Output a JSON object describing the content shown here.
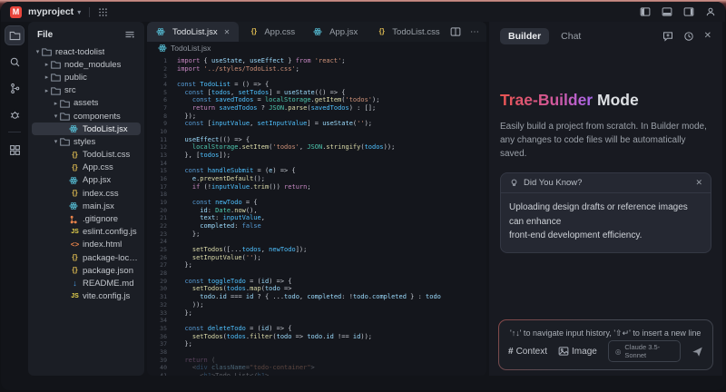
{
  "titlebar": {
    "logo_letter": "M",
    "project_name": "myproject",
    "right_icons": [
      "layout-left",
      "layout-bottom",
      "layout-right",
      "account"
    ]
  },
  "activity_bar": {
    "icons": [
      "files",
      "search",
      "source-control",
      "debug",
      "extensions"
    ],
    "active": "files"
  },
  "explorer": {
    "header": "File",
    "items": [
      {
        "indent": 0,
        "chevron": "v",
        "icon": "folder",
        "label": "react-todolist"
      },
      {
        "indent": 1,
        "chevron": ">",
        "icon": "folder",
        "label": "node_modules"
      },
      {
        "indent": 1,
        "chevron": ">",
        "icon": "folder",
        "label": "public"
      },
      {
        "indent": 1,
        "chevron": ">",
        "icon": "folder",
        "label": "src"
      },
      {
        "indent": 2,
        "chevron": ">",
        "icon": "folder",
        "label": "assets"
      },
      {
        "indent": 2,
        "chevron": "v",
        "icon": "folder",
        "label": "components"
      },
      {
        "indent": 3,
        "icon": "react",
        "label": "TodoList.jsx",
        "selected": true
      },
      {
        "indent": 2,
        "chevron": "v",
        "icon": "folder",
        "label": "styles"
      },
      {
        "indent": 3,
        "icon": "css",
        "label": "TodoList.css"
      },
      {
        "indent": 3,
        "icon": "css",
        "label": "App.css"
      },
      {
        "indent": 3,
        "icon": "react",
        "label": "App.jsx"
      },
      {
        "indent": 3,
        "icon": "css",
        "label": "index.css"
      },
      {
        "indent": 3,
        "icon": "react",
        "label": "main.jsx"
      },
      {
        "indent": 3,
        "icon": "git",
        "label": ".gitignore"
      },
      {
        "indent": 3,
        "icon": "js",
        "label": "eslint.config.js"
      },
      {
        "indent": 3,
        "icon": "html",
        "label": "index.html"
      },
      {
        "indent": 3,
        "icon": "json",
        "label": "package-lock.json"
      },
      {
        "indent": 3,
        "icon": "json",
        "label": "package.json"
      },
      {
        "indent": 3,
        "icon": "md",
        "label": "README.md"
      },
      {
        "indent": 3,
        "icon": "js",
        "label": "vite.config.js"
      }
    ]
  },
  "editor": {
    "tabs": [
      {
        "label": "TodoList.jsx",
        "icon": "react",
        "active": true,
        "close": true
      },
      {
        "label": "App.css",
        "icon": "css",
        "active": false
      },
      {
        "label": "App.jsx",
        "icon": "react",
        "active": false
      },
      {
        "label": "TodoList.css",
        "icon": "css",
        "active": false
      }
    ],
    "breadcrumb": "TodoList.jsx",
    "lines": [
      {
        "n": 1,
        "t": [
          "kw|import",
          "pn| { ",
          "id|useState",
          "pn|, ",
          "id|useEffect",
          "pn| } ",
          "kw|from",
          "st| 'react'",
          "pn|;"
        ]
      },
      {
        "n": 2,
        "t": [
          "kw|import",
          "st| '../styles/TodoList.css'",
          "pn|;"
        ]
      },
      {
        "n": 3,
        "t": []
      },
      {
        "n": 4,
        "t": [
          "cb|const ",
          "cn|TodoList",
          "pn| = () => {"
        ]
      },
      {
        "n": 5,
        "t": [
          "pn|  ",
          "cb|const ",
          "pn|[",
          "cn|todos",
          "pn|, ",
          "cn|setTodos",
          "pn|] = ",
          "id|useState",
          "pn|(() => {"
        ]
      },
      {
        "n": 6,
        "t": [
          "pn|    ",
          "cb|const ",
          "cn|savedTodos",
          "pn| = ",
          "tp|localStorage",
          "pn|.",
          "fn|getItem",
          "pn|(",
          "st|'todos'",
          "pn|);"
        ]
      },
      {
        "n": 7,
        "t": [
          "pn|    ",
          "kw|return ",
          "cn|savedTodos",
          "pn| ? ",
          "tp|JSON",
          "pn|.",
          "fn|parse",
          "pn|(",
          "cn|savedTodos",
          "pn|) : [];"
        ]
      },
      {
        "n": 8,
        "t": [
          "pn|  });"
        ]
      },
      {
        "n": 9,
        "t": [
          "pn|  ",
          "cb|const ",
          "pn|[",
          "cn|inputValue",
          "pn|, ",
          "cn|setInputValue",
          "pn|] = ",
          "id|useState",
          "pn|(",
          "st|''",
          "pn|);"
        ]
      },
      {
        "n": 10,
        "t": []
      },
      {
        "n": 11,
        "t": [
          "pn|  ",
          "id|useEffect",
          "pn|(() => {"
        ]
      },
      {
        "n": 12,
        "t": [
          "pn|    ",
          "tp|localStorage",
          "pn|.",
          "fn|setItem",
          "pn|(",
          "st|'todos'",
          "pn|, ",
          "tp|JSON",
          "pn|.",
          "fn|stringify",
          "pn|(",
          "cn|todos",
          "pn|));"
        ]
      },
      {
        "n": 13,
        "t": [
          "pn|  }, [",
          "cn|todos",
          "pn|]);"
        ]
      },
      {
        "n": 14,
        "t": []
      },
      {
        "n": 15,
        "t": [
          "pn|  ",
          "cb|const ",
          "cn|handleSubmit",
          "pn| = (",
          "id|e",
          "pn|) => {"
        ]
      },
      {
        "n": 16,
        "t": [
          "pn|    ",
          "id|e",
          "pn|.",
          "fn|preventDefault",
          "pn|();"
        ]
      },
      {
        "n": 17,
        "t": [
          "pn|    ",
          "kw|if",
          "pn| (!",
          "cn|inputValue",
          "pn|.",
          "fn|trim",
          "pn|()) ",
          "kw|return",
          "pn|;"
        ]
      },
      {
        "n": 18,
        "t": []
      },
      {
        "n": 19,
        "t": [
          "pn|    ",
          "cb|const ",
          "cn|newTodo",
          "pn| = {"
        ]
      },
      {
        "n": 20,
        "t": [
          "pn|      ",
          "id|id",
          "pn|: ",
          "tp|Date",
          "pn|.",
          "fn|now",
          "pn|(),"
        ]
      },
      {
        "n": 21,
        "t": [
          "pn|      ",
          "id|text",
          "pn|: ",
          "cn|inputValue",
          "pn|,"
        ]
      },
      {
        "n": 22,
        "t": [
          "pn|      ",
          "id|completed",
          "pn|: ",
          "cb|false"
        ]
      },
      {
        "n": 23,
        "t": [
          "pn|    };"
        ]
      },
      {
        "n": 24,
        "t": []
      },
      {
        "n": 25,
        "t": [
          "pn|    ",
          "fn|setTodos",
          "pn|([...",
          "cn|todos",
          "pn|, ",
          "cn|newTodo",
          "pn|]);"
        ]
      },
      {
        "n": 26,
        "t": [
          "pn|    ",
          "fn|setInputValue",
          "pn|(",
          "st|''",
          "pn|);"
        ]
      },
      {
        "n": 27,
        "t": [
          "pn|  };"
        ]
      },
      {
        "n": 28,
        "t": []
      },
      {
        "n": 29,
        "t": [
          "pn|  ",
          "cb|const ",
          "cn|toggleTodo",
          "pn| = (",
          "id|id",
          "pn|) => {"
        ]
      },
      {
        "n": 30,
        "t": [
          "pn|    ",
          "fn|setTodos",
          "pn|(",
          "cn|todos",
          "pn|.",
          "fn|map",
          "pn|(",
          "id|todo",
          "pn| =>"
        ]
      },
      {
        "n": 31,
        "t": [
          "pn|      ",
          "id|todo",
          "pn|.",
          "id|id",
          "pn| === ",
          "id|id",
          "pn| ? { ...",
          "id|todo",
          "pn|, ",
          "id|completed",
          "pn|: !",
          "id|todo",
          "pn|.",
          "id|completed",
          "pn| } : ",
          "id|todo"
        ]
      },
      {
        "n": 32,
        "t": [
          "pn|    ));"
        ]
      },
      {
        "n": 33,
        "t": [
          "pn|  };"
        ]
      },
      {
        "n": 34,
        "t": []
      },
      {
        "n": 35,
        "t": [
          "pn|  ",
          "cb|const ",
          "cn|deleteTodo",
          "pn| = (",
          "id|id",
          "pn|) => {"
        ]
      },
      {
        "n": 36,
        "t": [
          "pn|    ",
          "fn|setTodos",
          "pn|(",
          "cn|todos",
          "pn|.",
          "fn|filter",
          "pn|(",
          "id|todo",
          "pn| => ",
          "id|todo",
          "pn|.",
          "id|id",
          "pn| !== ",
          "id|id",
          "pn|));"
        ]
      },
      {
        "n": 37,
        "t": [
          "pn|  };"
        ]
      },
      {
        "n": 38,
        "t": []
      },
      {
        "n": 39,
        "dim": true,
        "t": [
          "pn|  ",
          "kw|return",
          "pn| ("
        ]
      },
      {
        "n": 40,
        "dim": true,
        "t": [
          "pn|    <",
          "tag|div",
          "pn| ",
          "at|className",
          "pn|=",
          "st|\"todo-container\"",
          "pn|>"
        ]
      },
      {
        "n": 41,
        "dim": true,
        "t": [
          "pn|      <",
          "tag|h1",
          "pn|>Todo List</",
          "tag|h1",
          "pn|>"
        ]
      }
    ]
  },
  "builder": {
    "tabs": [
      {
        "label": "Builder",
        "active": true
      },
      {
        "label": "Chat",
        "active": false
      }
    ],
    "header_icons": [
      "new-chat",
      "history"
    ],
    "close_label": "✕",
    "heading_gradient": "Trae-Builder",
    "heading_rest": " Mode",
    "description": "Easily build a project from scratch. In Builder mode,\nany changes to code files will be automatically saved.",
    "card": {
      "title": "Did You Know?",
      "close_label": "✕",
      "body": "Uploading design drafts or reference images can enhance\nfront-end development efficiency."
    },
    "input": {
      "placeholder": "'↑↓' to navigate input history, '⇧↵' to insert a new line",
      "context_hash": "#",
      "context_label": "Context",
      "image_label": "Image",
      "model_label": "Claude 3.5-Sonnet",
      "model_icon": "◎"
    }
  }
}
